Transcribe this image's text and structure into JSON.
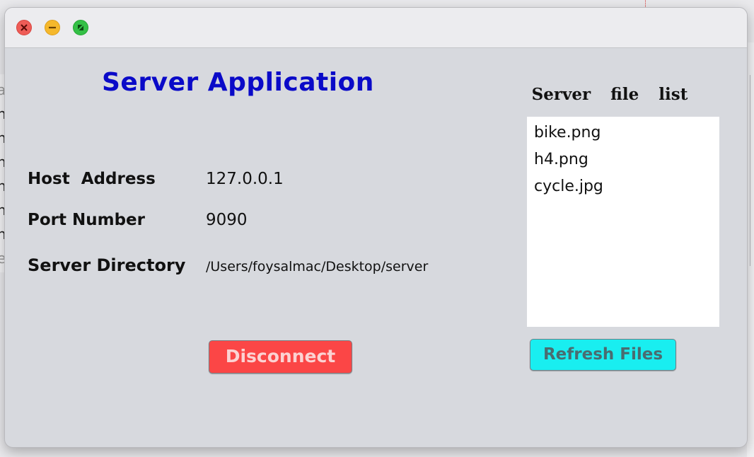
{
  "window": {
    "controls": {
      "close_icon": "close-icon",
      "minimize_icon": "minimize-icon",
      "maximize_icon": "fullscreen-icon"
    }
  },
  "app": {
    "title": "Server Application",
    "title_color": "#0a0ac8"
  },
  "fields": {
    "host": {
      "label": "Host  Address",
      "value": "127.0.0.1"
    },
    "port": {
      "label": "Port Number",
      "value": "9090"
    },
    "directory": {
      "label": "Server Directory",
      "value": "/Users/foysalmac/Desktop/server"
    }
  },
  "buttons": {
    "disconnect": {
      "label": "Disconnect",
      "color": "#fb4646"
    },
    "refresh": {
      "label": "Refresh Files",
      "color": "#19eef0"
    }
  },
  "file_list": {
    "heading": "Server  file  list",
    "items": [
      "bike.png",
      "h4.png",
      "cycle.jpg"
    ]
  },
  "background_window": {
    "glyphs": [
      "a",
      "n",
      "n",
      "n",
      "n",
      "n",
      "n",
      "e"
    ]
  }
}
